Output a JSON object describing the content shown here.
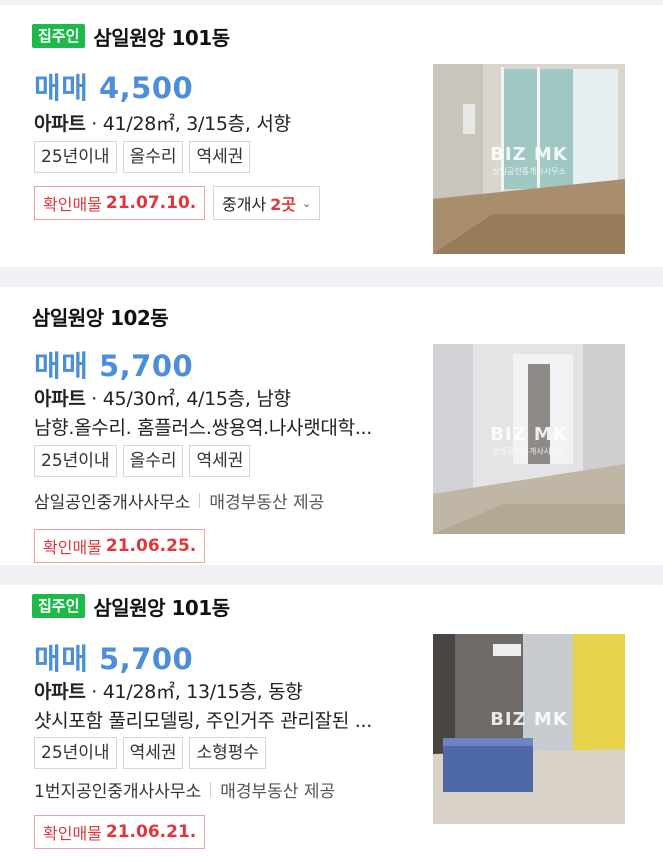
{
  "listings": [
    {
      "owner_badge": "집주인",
      "complex": "삼일원앙 101동",
      "price": "매매 4,500",
      "type": "아파트",
      "spec": " · 41/28㎡, 3/15층, 서향",
      "tags": [
        "25년이내",
        "올수리",
        "역세권"
      ],
      "confirm_label": "확인매물",
      "confirm_date": "21.07.10.",
      "broker_label": "중개사",
      "broker_count": "2곳",
      "watermark": "BIZ MK",
      "watermark_sub": "삼일공인중개사사무소"
    },
    {
      "complex": "삼일원앙 102동",
      "price": "매매 5,700",
      "type": "아파트",
      "spec": " · 45/30㎡, 4/15층, 남향",
      "description": "남향.올수리. 홈플러스.쌍용역.나사랫대학...",
      "tags": [
        "25년이내",
        "올수리",
        "역세권"
      ],
      "agency": "삼일공인중개사사무소",
      "provider": "매경부동산 제공",
      "confirm_label": "확인매물",
      "confirm_date": "21.06.25.",
      "watermark": "BIZ MK",
      "watermark_sub": "삼일공인중개사사무소"
    },
    {
      "owner_badge": "집주인",
      "complex": "삼일원앙 101동",
      "price": "매매 5,700",
      "type": "아파트",
      "spec": " · 41/28㎡, 13/15층, 동향",
      "description": "샷시포함 풀리모델링, 주인거주 관리잘된 ...",
      "tags": [
        "25년이내",
        "역세권",
        "소형평수"
      ],
      "agency": "1번지공인중개사사무소",
      "provider": "매경부동산 제공",
      "confirm_label": "확인매물",
      "confirm_date": "21.06.21.",
      "watermark": "BIZ MK"
    }
  ],
  "colors": {
    "price": "#4c8fd6",
    "owner_badge": "#1db94a",
    "confirm": "#e0373d"
  }
}
